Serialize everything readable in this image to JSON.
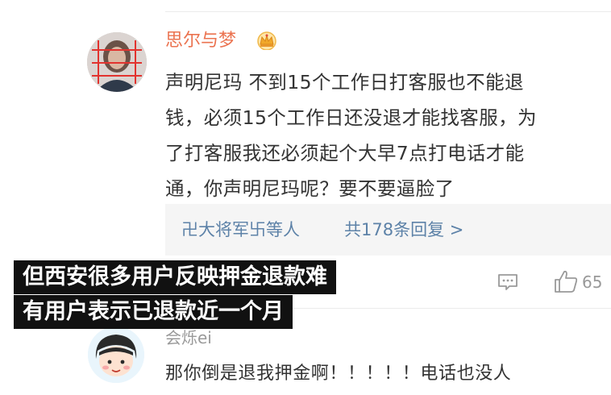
{
  "comment1": {
    "username": "思尔与梦",
    "badge_icon": "crown-badge-icon",
    "text": "声明尼玛 不到15个工作日打客服也不能退\n钱，必须15个工作日还没退才能找客服，为\n了打客服我还必须起个大早7点打电话才能\n通，你声明尼玛呢？要不要逼脸了",
    "reply_users": "卍大将军卐等人",
    "reply_count": "共178条回复 >",
    "like_count": "65"
  },
  "comment2": {
    "username": "会烁ei",
    "text": "那你倒是退我押金啊！！！！！电话也没人"
  },
  "captions": {
    "line1": "但西安很多用户反映押金退款难",
    "line2": "有用户表示已退款近一个月"
  },
  "colors": {
    "username": "#eb7350",
    "link": "#5d82a8",
    "caption_bg": "#111111"
  }
}
